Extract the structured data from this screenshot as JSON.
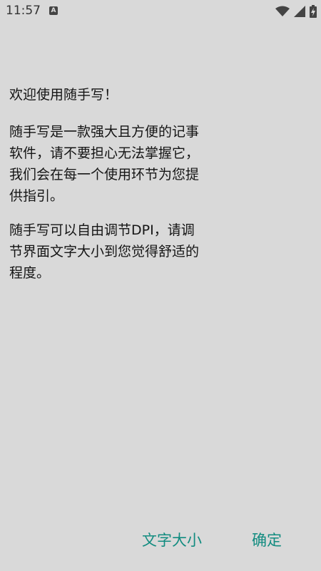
{
  "status_bar": {
    "time": "11:57",
    "notification_glyph": "A",
    "icons": [
      "wifi-icon",
      "signal-icon",
      "battery-charging-icon"
    ]
  },
  "welcome": {
    "greeting": "欢迎使用随手写！",
    "paragraphs": [
      "随手写是一款强大且方便的记事软件，请不要担心无法掌握它，我们会在每一个使用环节为您提供指引。",
      "随手写可以自由调节DPI，请调节界面文字大小到您觉得舒适的程度。"
    ]
  },
  "actions": {
    "font_size_label": "文字大小",
    "confirm_label": "确定"
  },
  "colors": {
    "background": "#d9d9d9",
    "accent": "#128c80",
    "text": "#151515"
  }
}
